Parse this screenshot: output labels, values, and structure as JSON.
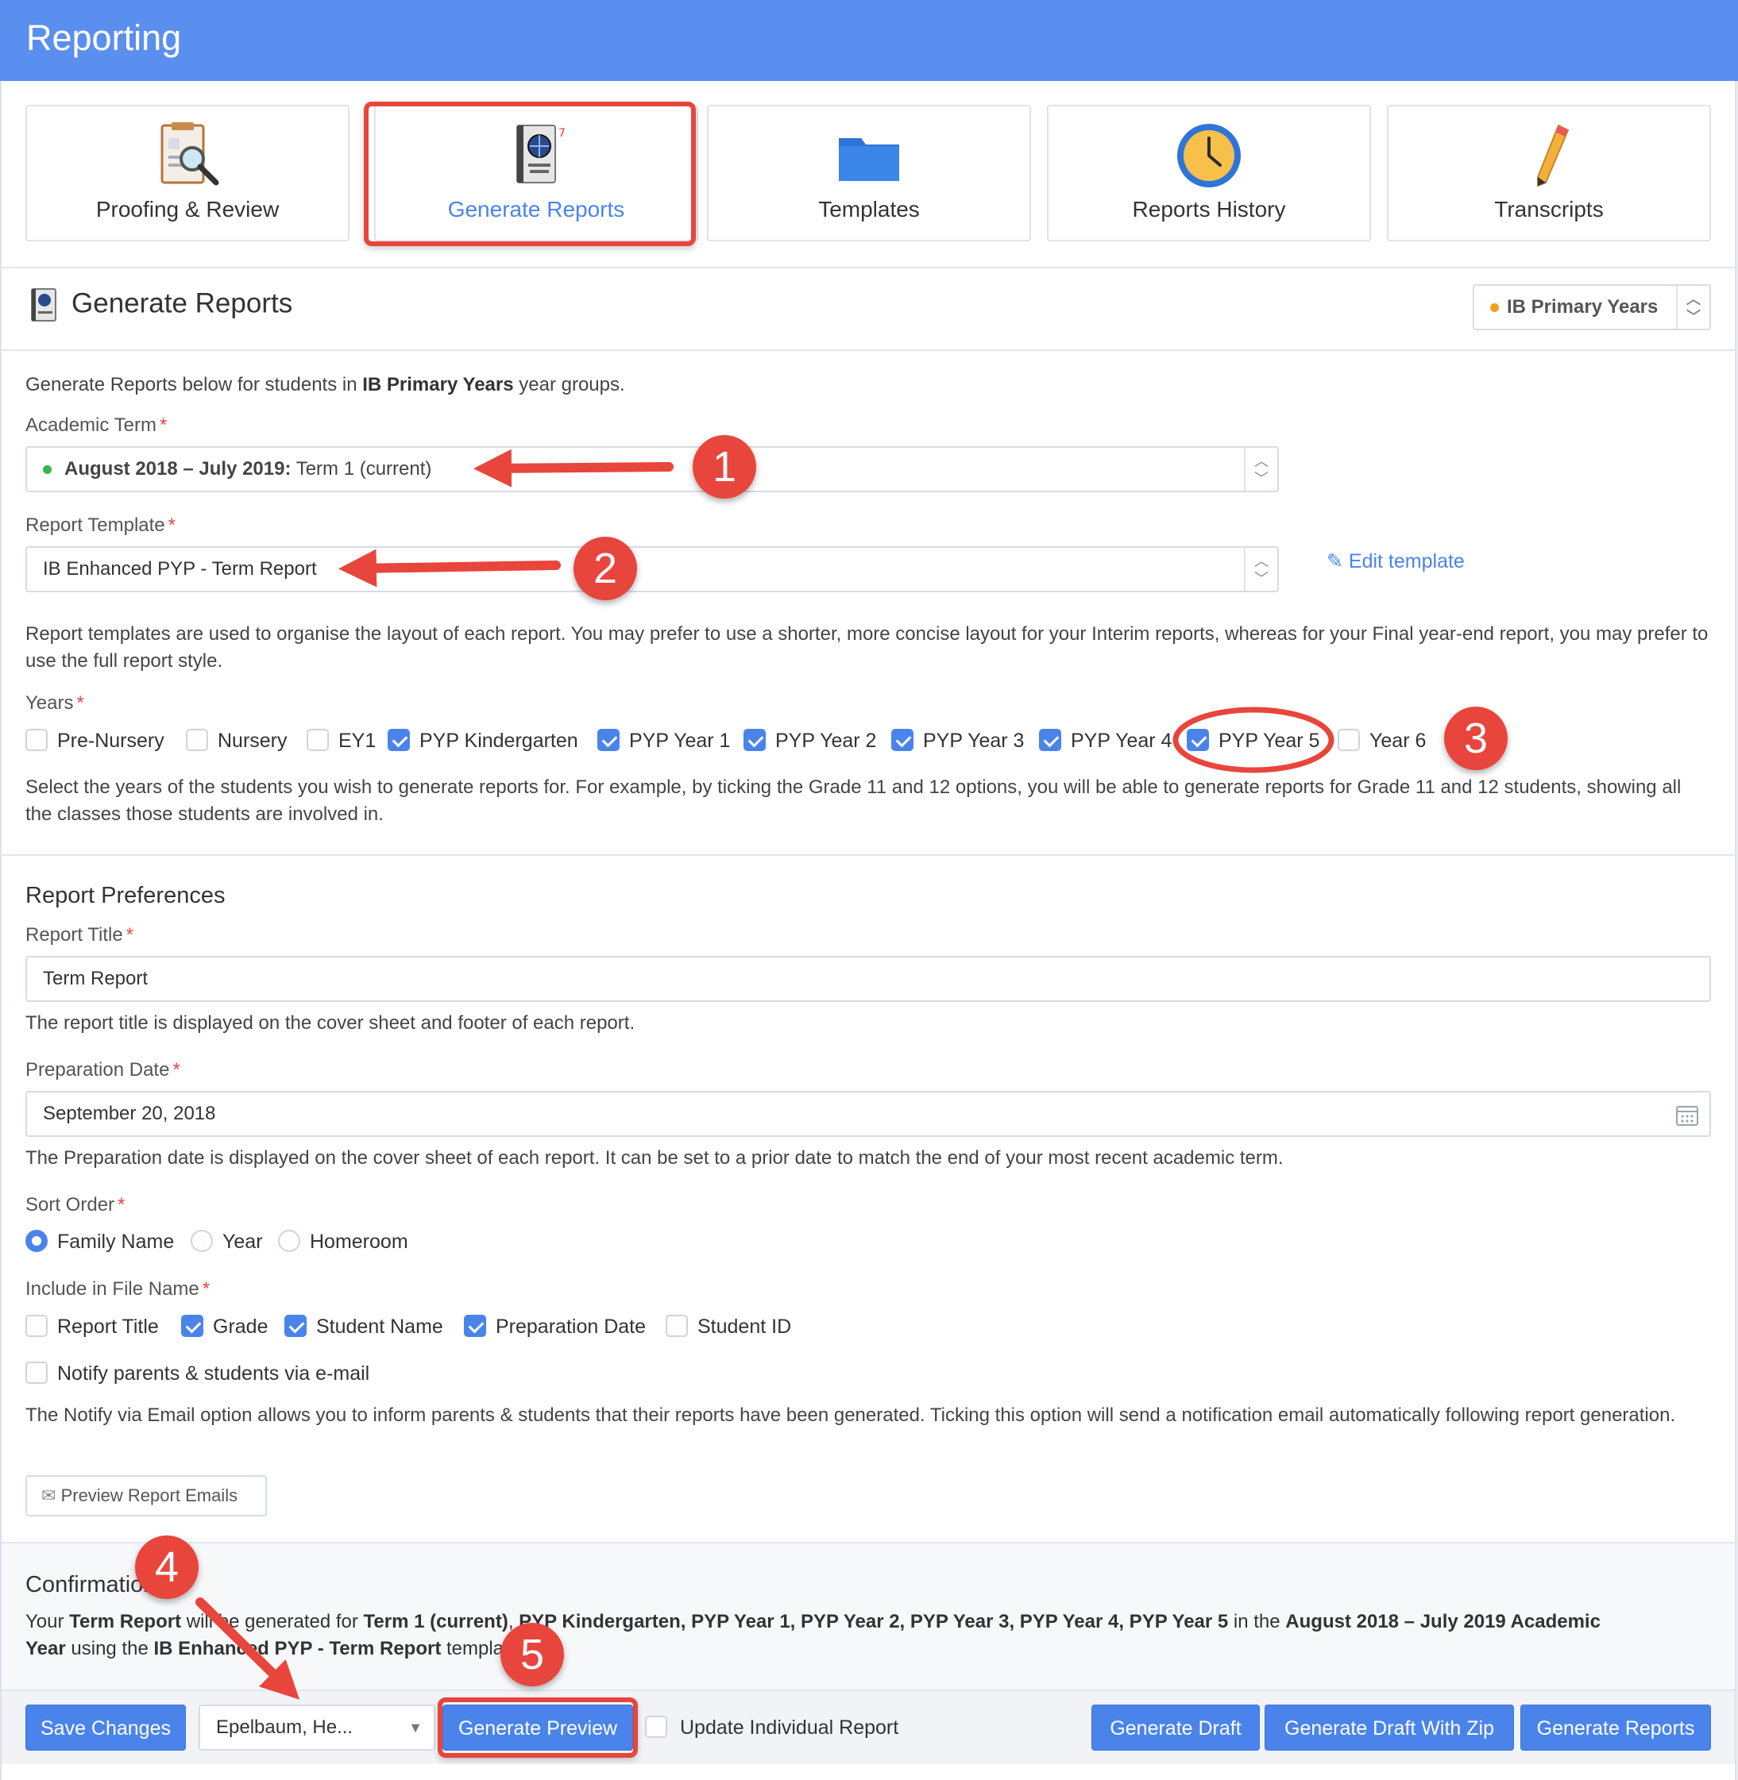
{
  "header": {
    "title": "Reporting"
  },
  "tiles": [
    {
      "label": "Proofing & Review",
      "icon": "proofing-icon"
    },
    {
      "label": "Generate Reports",
      "icon": "report-cards-icon"
    },
    {
      "label": "Templates",
      "icon": "folder-icon"
    },
    {
      "label": "Reports History",
      "icon": "clock-icon"
    },
    {
      "label": "Transcripts",
      "icon": "pencil-icon"
    }
  ],
  "section": {
    "title": "Generate Reports",
    "program_selector": "IB Primary Years"
  },
  "intro": {
    "before": "Generate Reports below for students in ",
    "bold": "IB Primary Years",
    "after": " year groups."
  },
  "academic_term": {
    "label": "Academic Term",
    "value_bold": "August 2018 – July 2019:",
    "value_rest": " Term 1 (current)"
  },
  "report_template": {
    "label": "Report Template",
    "value": "IB Enhanced PYP - Term Report",
    "edit_link": "Edit template",
    "help": "Report templates are used to organise the layout of each report. You may prefer to use a shorter, more concise layout for your Interim reports, whereas for your Final year-end report, you may prefer to use the full report style."
  },
  "years": {
    "label": "Years",
    "options": [
      "Pre-Nursery",
      "Nursery",
      "EY1",
      "PYP Kindergarten",
      "PYP Year 1",
      "PYP Year 2",
      "PYP Year 3",
      "PYP Year 4",
      "PYP Year 5",
      "Year 6"
    ],
    "checked": [
      false,
      false,
      false,
      true,
      true,
      true,
      true,
      true,
      true,
      false
    ],
    "help": "Select the years of the students you wish to generate reports for. For example, by ticking the Grade 11 and 12 options, you will be able to generate reports for Grade 11 and 12 students, showing all the classes those students are involved in."
  },
  "prefs": {
    "heading": "Report Preferences",
    "report_title_label": "Report Title",
    "report_title_value": "Term Report",
    "report_title_help": "The report title is displayed on the cover sheet and footer of each report.",
    "prep_date_label": "Preparation Date",
    "prep_date_value": "September 20, 2018",
    "prep_date_help": "The Preparation date is displayed on the cover sheet of each report. It can be set to a prior date to match the end of your most recent academic term.",
    "sort_label": "Sort Order",
    "sort_options": [
      "Family Name",
      "Year",
      "Homeroom"
    ],
    "sort_selected": "Family Name",
    "filename_label": "Include in File Name",
    "filename_options": [
      "Report Title",
      "Grade",
      "Student Name",
      "Preparation Date",
      "Student ID"
    ],
    "filename_checked": [
      false,
      true,
      true,
      true,
      false
    ],
    "notify_label": "Notify parents & students via e-mail",
    "notify_help": "The Notify via Email option allows you to inform parents & students that their reports have been generated. Ticking this option will send a notification email automatically following report generation.",
    "preview_emails": "Preview Report Emails"
  },
  "confirmation": {
    "heading": "Confirmation",
    "line1_html": "Your <b>Term Report</b> will be generated for <b>Term 1 (current)</b>, <b>PYP Kindergarten, PYP Year 1, PYP Year 2, PYP Year 3, PYP Year 4, PYP Year 5</b> in the <b>August 2018 – July 2019 Academic</b>",
    "line2_html": "<b>Year</b> using the <b>IB Enhanced PYP - Term Report</b> template."
  },
  "footer": {
    "save": "Save Changes",
    "student_select": "Epelbaum, He...",
    "preview": "Generate Preview",
    "update_individual": "Update Individual Report",
    "draft": "Generate Draft",
    "draft_zip": "Generate Draft With Zip",
    "generate": "Generate Reports"
  },
  "annotations": [
    "1",
    "2",
    "3",
    "4",
    "5"
  ],
  "colors": {
    "header": "#5b8fef",
    "accent": "#4a84ea",
    "annotation": "#e8453c",
    "term_dot": "#39b54a",
    "program_dot": "#f0a020"
  }
}
